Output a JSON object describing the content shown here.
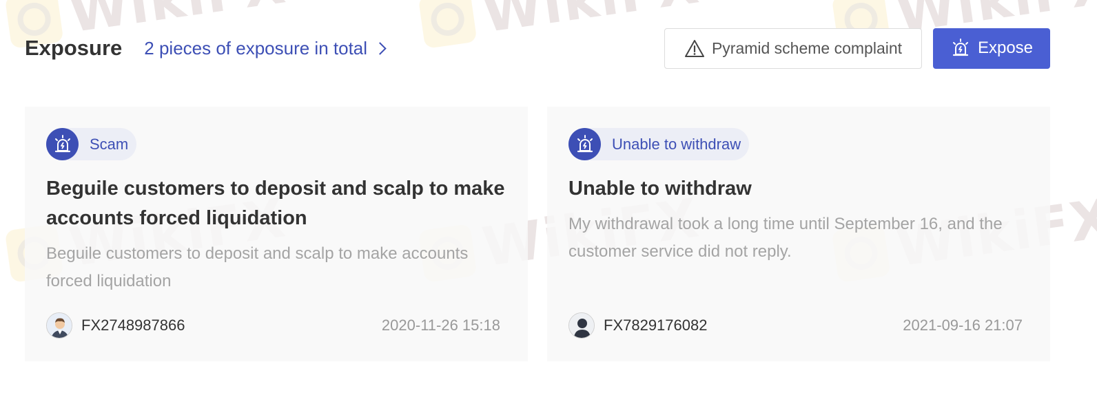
{
  "header": {
    "title": "Exposure",
    "total_link": "2 pieces of exposure in total",
    "complaint_button": "Pyramid scheme complaint",
    "expose_button": "Expose"
  },
  "watermark": {
    "text": "WikiFX"
  },
  "cards": [
    {
      "tag": "Scam",
      "title": "Beguile customers to deposit and scalp to make accounts forced liquidation",
      "description": "Beguile customers to deposit and scalp to make accounts forced liquidation",
      "user": "FX2748987866",
      "date": "2020-11-26 15:18",
      "avatar": "man-suit-avatar"
    },
    {
      "tag": "Unable to withdraw",
      "title": "Unable to withdraw",
      "description": "My withdrawal took a long time until September 16, and the customer service did not reply.",
      "user": "FX7829176082",
      "date": "2021-09-16 21:07",
      "avatar": "person-silhouette-avatar"
    }
  ],
  "colors": {
    "accent": "#3d4fb5",
    "button_primary": "#4a5fd3",
    "tag_bg": "#eceef6",
    "muted_text": "#a4a4a4"
  },
  "icons": {
    "complaint": "warning-triangle-icon",
    "expose": "alarm-siren-icon",
    "tag": "alarm-siren-icon",
    "link": "chevron-right-icon"
  }
}
